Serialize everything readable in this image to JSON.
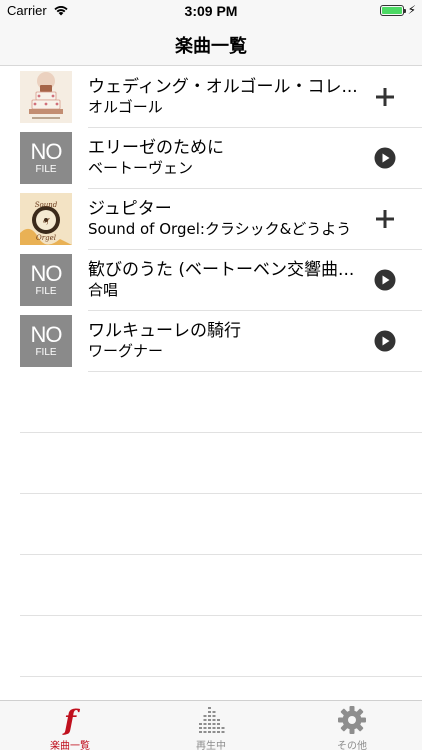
{
  "status_bar": {
    "carrier": "Carrier",
    "time": "3:09 PM",
    "charging_glyph": "⚡",
    "battery_level": 1.0
  },
  "nav": {
    "title": "楽曲一覧"
  },
  "songs": [
    {
      "title": "ウェディング・オルゴール・コレ...",
      "subtitle": "オルゴール",
      "artwork": "cake-artwork",
      "action": "add-icon"
    },
    {
      "title": "エリーゼのために",
      "subtitle": "ベートーヴェン",
      "artwork": "no-file",
      "action": "play-icon",
      "nofile_big": "NO",
      "nofile_small": "FILE"
    },
    {
      "title": "ジュピター",
      "subtitle": "Sound of Orgel:クラシック&どうよう",
      "artwork": "orgel-artwork",
      "action": "add-icon"
    },
    {
      "title": "歓びのうた (ベートーベン交響曲...",
      "subtitle": "合唱",
      "artwork": "no-file",
      "action": "play-icon",
      "nofile_big": "NO",
      "nofile_small": "FILE"
    },
    {
      "title": "ワルキューレの騎行",
      "subtitle": "ワーグナー",
      "artwork": "no-file",
      "action": "play-icon",
      "nofile_big": "NO",
      "nofile_small": "FILE"
    }
  ],
  "tabs": [
    {
      "label": "楽曲一覧",
      "icon": "music-f-icon",
      "active": true
    },
    {
      "label": "再生中",
      "icon": "equalizer-icon",
      "active": false
    },
    {
      "label": "その他",
      "icon": "gear-icon",
      "active": false
    }
  ],
  "colors": {
    "accent": "#c0101e",
    "tab_inactive": "#8e8e8e",
    "nofile_gray": "#8a8a8a",
    "action_dark": "#333333"
  }
}
